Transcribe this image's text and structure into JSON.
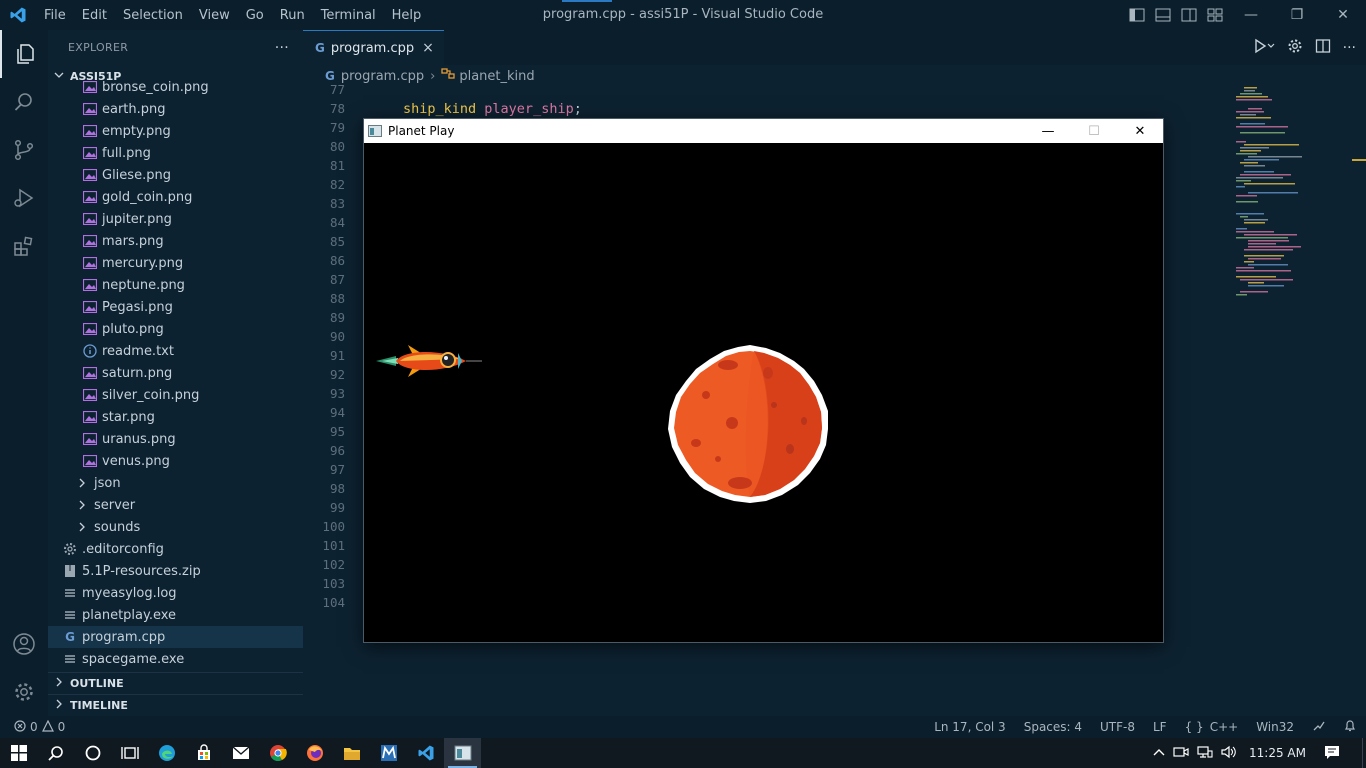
{
  "titlebar": {
    "menu": [
      "File",
      "Edit",
      "Selection",
      "View",
      "Go",
      "Run",
      "Terminal",
      "Help"
    ],
    "title": "program.cpp - assi51P - Visual Studio Code"
  },
  "explorer": {
    "header": "EXPLORER",
    "more": "···",
    "root": "ASSI51P",
    "files": [
      {
        "name": "bronse_coin.png",
        "type": "image"
      },
      {
        "name": "earth.png",
        "type": "image"
      },
      {
        "name": "empty.png",
        "type": "image"
      },
      {
        "name": "full.png",
        "type": "image"
      },
      {
        "name": "Gliese.png",
        "type": "image"
      },
      {
        "name": "gold_coin.png",
        "type": "image"
      },
      {
        "name": "jupiter.png",
        "type": "image"
      },
      {
        "name": "mars.png",
        "type": "image"
      },
      {
        "name": "mercury.png",
        "type": "image"
      },
      {
        "name": "neptune.png",
        "type": "image"
      },
      {
        "name": "Pegasi.png",
        "type": "image"
      },
      {
        "name": "pluto.png",
        "type": "image"
      },
      {
        "name": "readme.txt",
        "type": "info"
      },
      {
        "name": "saturn.png",
        "type": "image"
      },
      {
        "name": "silver_coin.png",
        "type": "image"
      },
      {
        "name": "star.png",
        "type": "image"
      },
      {
        "name": "uranus.png",
        "type": "image"
      },
      {
        "name": "venus.png",
        "type": "image"
      }
    ],
    "folders": [
      "json",
      "server",
      "sounds"
    ],
    "rootfiles": [
      {
        "name": ".editorconfig",
        "type": "gear"
      },
      {
        "name": "5.1P-resources.zip",
        "type": "zip"
      },
      {
        "name": "myeasylog.log",
        "type": "lines"
      },
      {
        "name": "planetplay.exe",
        "type": "lines"
      },
      {
        "name": "program.cpp",
        "type": "cpp",
        "selected": true
      },
      {
        "name": "spacegame.exe",
        "type": "lines"
      }
    ],
    "outline": "OUTLINE",
    "timeline": "TIMELINE"
  },
  "editor": {
    "tab_label": "program.cpp",
    "tab_close": "×",
    "breadcrumb_file": "program.cpp",
    "breadcrumb_symbol": "planet_kind",
    "line_numbers": [
      "77",
      "78",
      "79",
      "80",
      "81",
      "82",
      "83",
      "84",
      "85",
      "86",
      "87",
      "88",
      "89",
      "90",
      "91",
      "92",
      "93",
      "94",
      "95",
      "96",
      "97",
      "98",
      "99",
      "100",
      "101",
      "102",
      "103",
      "104"
    ],
    "code_type": "ship_kind",
    "code_var": "player_ship",
    "code_end": ";"
  },
  "game_window": {
    "title": "Planet Play"
  },
  "statusbar": {
    "errors": "0",
    "warnings": "0",
    "position": "Ln 17, Col 3",
    "spaces": "Spaces: 4",
    "encoding": "UTF-8",
    "eol": "LF",
    "language": "C++",
    "platform": "Win32"
  },
  "taskbar": {
    "time": "11:25 AM"
  },
  "colors": {
    "accent": "#2b79c2",
    "keyword": "#f2c94c",
    "variable": "#e07aa6",
    "planet": "#ee5a24"
  }
}
